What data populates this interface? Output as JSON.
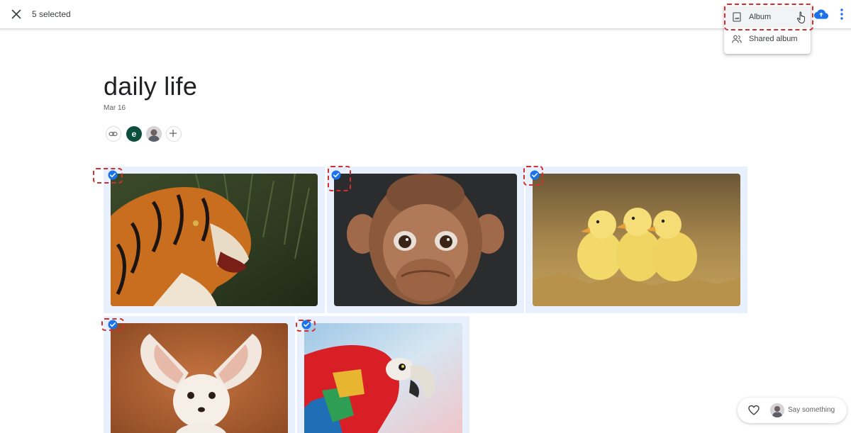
{
  "topbar": {
    "selected_label": "5 selected",
    "close_icon": "close-icon",
    "cloud_icon": "cloud-upload-icon",
    "more_icon": "more-vertical-icon"
  },
  "menu": {
    "items": [
      {
        "label": "Album",
        "icon": "album-icon"
      },
      {
        "label": "Shared album",
        "icon": "people-icon"
      }
    ]
  },
  "album": {
    "title": "daily life",
    "date": "Mar 16",
    "avatar_letter": "e"
  },
  "photos": [
    {
      "subject": "tiger",
      "selected": true
    },
    {
      "subject": "monkey",
      "selected": true
    },
    {
      "subject": "ducklings",
      "selected": true
    },
    {
      "subject": "fennec fox",
      "selected": true
    },
    {
      "subject": "parrot",
      "selected": true
    }
  ],
  "comment": {
    "placeholder": "Say something"
  },
  "colors": {
    "accent": "#1a73e8",
    "highlight": "#d32f2f",
    "tile_bg": "#e8f0fe"
  }
}
